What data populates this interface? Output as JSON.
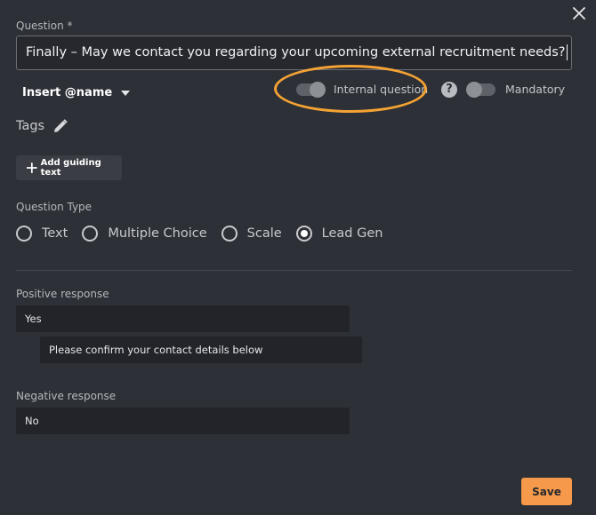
{
  "dialog": {
    "question_label": "Question *",
    "question_value": "Finally – May we contact you regarding your upcoming external recruitment needs?",
    "insert_label": "Insert @name",
    "internal_question_label": "Internal question",
    "help_glyph": "?",
    "mandatory_label": "Mandatory",
    "tags_label": "Tags",
    "add_guiding_text_label": "Add guiding text",
    "question_type_label": "Question Type",
    "question_types": [
      {
        "label": "Text",
        "selected": false
      },
      {
        "label": "Multiple Choice",
        "selected": false
      },
      {
        "label": "Scale",
        "selected": false
      },
      {
        "label": "Lead Gen",
        "selected": true
      }
    ],
    "positive_response_label": "Positive response",
    "positive_response_value": "Yes",
    "positive_followup_value": "Please confirm your contact details below",
    "negative_response_label": "Negative response",
    "negative_response_value": "No",
    "save_label": "Save"
  },
  "toggles": {
    "internal_question_on": true,
    "mandatory_on": false
  },
  "colors": {
    "background": "#2d3036",
    "accent_orange": "#f6994a",
    "highlight_ring": "#f4a234"
  },
  "icons": [
    "close-icon",
    "caret-down-icon",
    "help-icon",
    "pencil-icon",
    "plus-icon"
  ]
}
